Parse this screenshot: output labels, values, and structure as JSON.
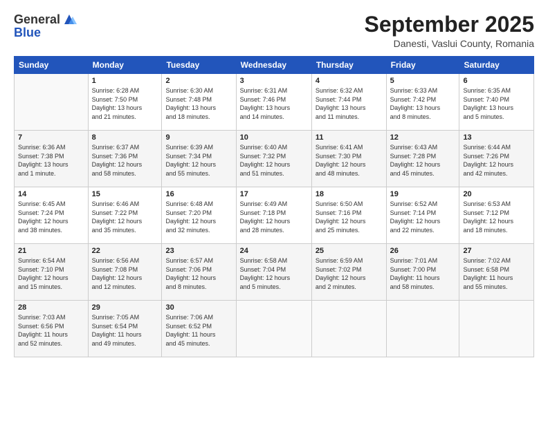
{
  "header": {
    "logo_line1": "General",
    "logo_line2": "Blue",
    "month": "September 2025",
    "location": "Danesti, Vaslui County, Romania"
  },
  "weekdays": [
    "Sunday",
    "Monday",
    "Tuesday",
    "Wednesday",
    "Thursday",
    "Friday",
    "Saturday"
  ],
  "weeks": [
    [
      {
        "day": "",
        "info": ""
      },
      {
        "day": "1",
        "info": "Sunrise: 6:28 AM\nSunset: 7:50 PM\nDaylight: 13 hours\nand 21 minutes."
      },
      {
        "day": "2",
        "info": "Sunrise: 6:30 AM\nSunset: 7:48 PM\nDaylight: 13 hours\nand 18 minutes."
      },
      {
        "day": "3",
        "info": "Sunrise: 6:31 AM\nSunset: 7:46 PM\nDaylight: 13 hours\nand 14 minutes."
      },
      {
        "day": "4",
        "info": "Sunrise: 6:32 AM\nSunset: 7:44 PM\nDaylight: 13 hours\nand 11 minutes."
      },
      {
        "day": "5",
        "info": "Sunrise: 6:33 AM\nSunset: 7:42 PM\nDaylight: 13 hours\nand 8 minutes."
      },
      {
        "day": "6",
        "info": "Sunrise: 6:35 AM\nSunset: 7:40 PM\nDaylight: 13 hours\nand 5 minutes."
      }
    ],
    [
      {
        "day": "7",
        "info": "Sunrise: 6:36 AM\nSunset: 7:38 PM\nDaylight: 13 hours\nand 1 minute."
      },
      {
        "day": "8",
        "info": "Sunrise: 6:37 AM\nSunset: 7:36 PM\nDaylight: 12 hours\nand 58 minutes."
      },
      {
        "day": "9",
        "info": "Sunrise: 6:39 AM\nSunset: 7:34 PM\nDaylight: 12 hours\nand 55 minutes."
      },
      {
        "day": "10",
        "info": "Sunrise: 6:40 AM\nSunset: 7:32 PM\nDaylight: 12 hours\nand 51 minutes."
      },
      {
        "day": "11",
        "info": "Sunrise: 6:41 AM\nSunset: 7:30 PM\nDaylight: 12 hours\nand 48 minutes."
      },
      {
        "day": "12",
        "info": "Sunrise: 6:43 AM\nSunset: 7:28 PM\nDaylight: 12 hours\nand 45 minutes."
      },
      {
        "day": "13",
        "info": "Sunrise: 6:44 AM\nSunset: 7:26 PM\nDaylight: 12 hours\nand 42 minutes."
      }
    ],
    [
      {
        "day": "14",
        "info": "Sunrise: 6:45 AM\nSunset: 7:24 PM\nDaylight: 12 hours\nand 38 minutes."
      },
      {
        "day": "15",
        "info": "Sunrise: 6:46 AM\nSunset: 7:22 PM\nDaylight: 12 hours\nand 35 minutes."
      },
      {
        "day": "16",
        "info": "Sunrise: 6:48 AM\nSunset: 7:20 PM\nDaylight: 12 hours\nand 32 minutes."
      },
      {
        "day": "17",
        "info": "Sunrise: 6:49 AM\nSunset: 7:18 PM\nDaylight: 12 hours\nand 28 minutes."
      },
      {
        "day": "18",
        "info": "Sunrise: 6:50 AM\nSunset: 7:16 PM\nDaylight: 12 hours\nand 25 minutes."
      },
      {
        "day": "19",
        "info": "Sunrise: 6:52 AM\nSunset: 7:14 PM\nDaylight: 12 hours\nand 22 minutes."
      },
      {
        "day": "20",
        "info": "Sunrise: 6:53 AM\nSunset: 7:12 PM\nDaylight: 12 hours\nand 18 minutes."
      }
    ],
    [
      {
        "day": "21",
        "info": "Sunrise: 6:54 AM\nSunset: 7:10 PM\nDaylight: 12 hours\nand 15 minutes."
      },
      {
        "day": "22",
        "info": "Sunrise: 6:56 AM\nSunset: 7:08 PM\nDaylight: 12 hours\nand 12 minutes."
      },
      {
        "day": "23",
        "info": "Sunrise: 6:57 AM\nSunset: 7:06 PM\nDaylight: 12 hours\nand 8 minutes."
      },
      {
        "day": "24",
        "info": "Sunrise: 6:58 AM\nSunset: 7:04 PM\nDaylight: 12 hours\nand 5 minutes."
      },
      {
        "day": "25",
        "info": "Sunrise: 6:59 AM\nSunset: 7:02 PM\nDaylight: 12 hours\nand 2 minutes."
      },
      {
        "day": "26",
        "info": "Sunrise: 7:01 AM\nSunset: 7:00 PM\nDaylight: 11 hours\nand 58 minutes."
      },
      {
        "day": "27",
        "info": "Sunrise: 7:02 AM\nSunset: 6:58 PM\nDaylight: 11 hours\nand 55 minutes."
      }
    ],
    [
      {
        "day": "28",
        "info": "Sunrise: 7:03 AM\nSunset: 6:56 PM\nDaylight: 11 hours\nand 52 minutes."
      },
      {
        "day": "29",
        "info": "Sunrise: 7:05 AM\nSunset: 6:54 PM\nDaylight: 11 hours\nand 49 minutes."
      },
      {
        "day": "30",
        "info": "Sunrise: 7:06 AM\nSunset: 6:52 PM\nDaylight: 11 hours\nand 45 minutes."
      },
      {
        "day": "",
        "info": ""
      },
      {
        "day": "",
        "info": ""
      },
      {
        "day": "",
        "info": ""
      },
      {
        "day": "",
        "info": ""
      }
    ]
  ]
}
